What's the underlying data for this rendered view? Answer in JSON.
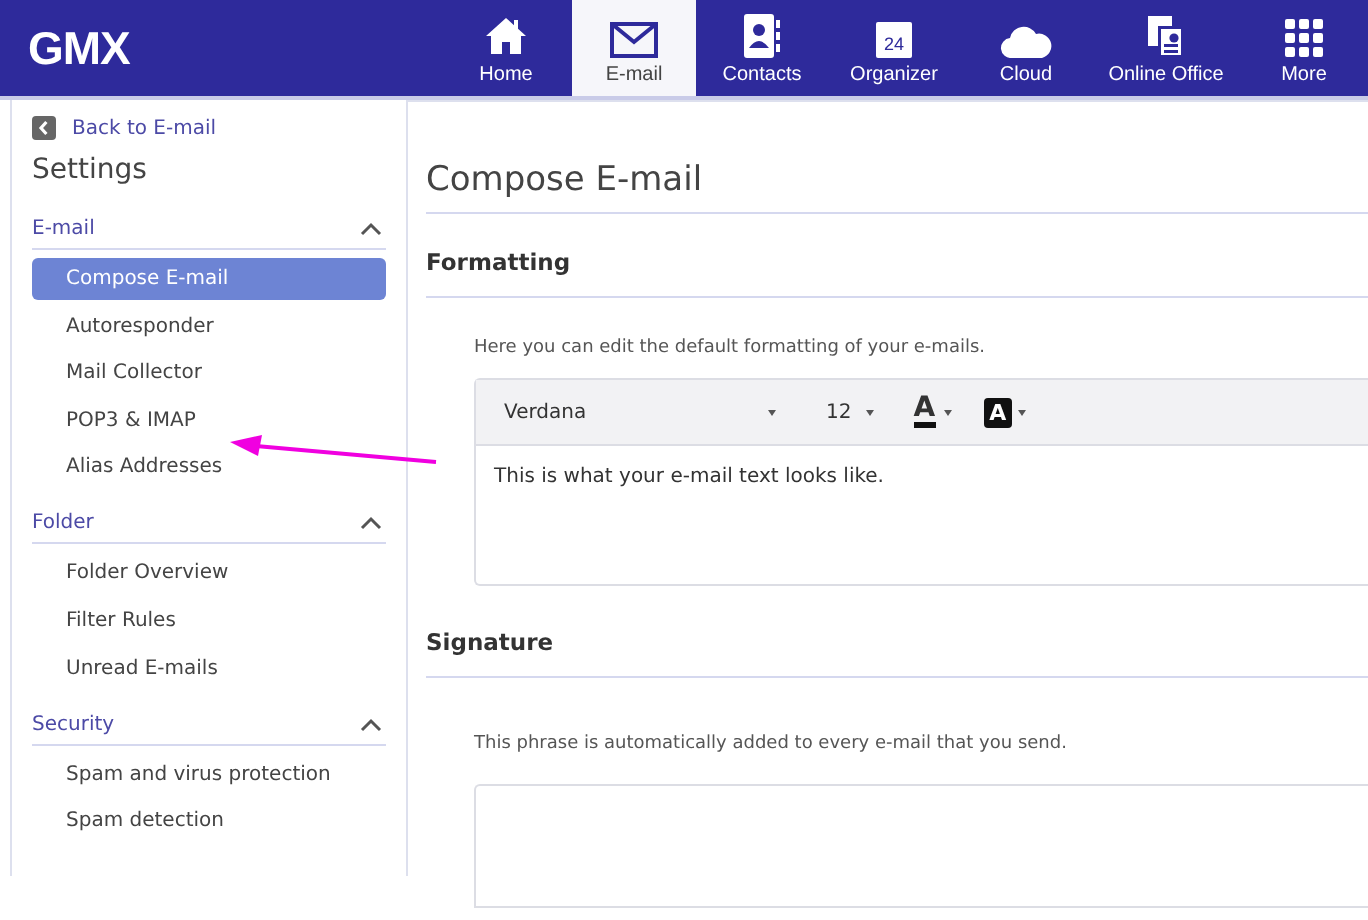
{
  "logo": "GMX",
  "nav": [
    {
      "label": "Home",
      "selected": false
    },
    {
      "label": "E-mail",
      "selected": true
    },
    {
      "label": "Contacts",
      "selected": false
    },
    {
      "label": "Organizer",
      "selected": false,
      "icon_text": "24"
    },
    {
      "label": "Cloud",
      "selected": false
    },
    {
      "label": "Online Office",
      "selected": false
    },
    {
      "label": "More",
      "selected": false
    }
  ],
  "sidebar": {
    "back": "Back to E-mail",
    "title": "Settings",
    "sections": [
      {
        "title": "E-mail",
        "expanded": true,
        "items": [
          {
            "label": "Compose E-mail",
            "selected": true
          },
          {
            "label": "Autoresponder",
            "selected": false
          },
          {
            "label": "Mail Collector",
            "selected": false
          },
          {
            "label": "POP3 & IMAP",
            "selected": false
          },
          {
            "label": "Alias Addresses",
            "selected": false
          }
        ]
      },
      {
        "title": "Folder",
        "expanded": true,
        "items": [
          {
            "label": "Folder Overview",
            "selected": false
          },
          {
            "label": "Filter Rules",
            "selected": false
          },
          {
            "label": "Unread E-mails",
            "selected": false
          }
        ]
      },
      {
        "title": "Security",
        "expanded": true,
        "items": [
          {
            "label": "Spam and virus protection",
            "selected": false
          },
          {
            "label": "Spam detection",
            "selected": false
          }
        ]
      }
    ]
  },
  "main": {
    "title": "Compose E-mail",
    "formatting": {
      "heading": "Formatting",
      "description": "Here you can edit the default formatting of your e-mails.",
      "font": "Verdana",
      "size": "12",
      "text_color_glyph": "A",
      "highlight_glyph": "A",
      "preview": "This is what your e-mail text looks like."
    },
    "signature": {
      "heading": "Signature",
      "description": "This phrase is automatically added to every e-mail that you send."
    }
  }
}
